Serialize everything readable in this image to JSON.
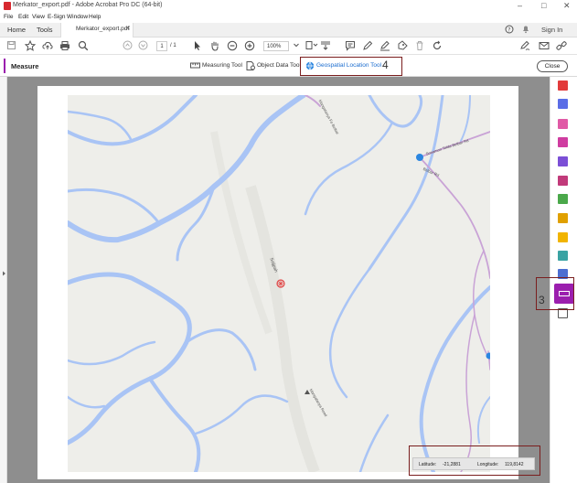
{
  "window": {
    "title": "Merkator_export.pdf - Adobe Acrobat Pro DC (64-bit)",
    "controls": [
      "–",
      "□",
      "✕"
    ]
  },
  "menu": [
    "File",
    "Edit",
    "View",
    "E-Sign",
    "Window",
    "Help"
  ],
  "tabs": {
    "home": "Home",
    "tools": "Tools",
    "document": "Merkator_export.pdf",
    "document_close": "✕",
    "sign_in": "Sign In"
  },
  "toolbar": {
    "page_current": "1",
    "page_total": "/ 1",
    "zoom": "100%"
  },
  "measure": {
    "title": "Measure",
    "tools": [
      "Measuring Tool",
      "Object Data Tool",
      "Geospatial Location Tool"
    ],
    "close": "Close",
    "callout_number": "4"
  },
  "sidebar": {
    "callout_number": "3"
  },
  "map_labels": {
    "village": "Saijpah",
    "road_1": "Sonamon Tolda Belbar Rd",
    "road_2": "Belbar Rd",
    "road_3": "Mangatanya Road",
    "road_4": "Mangatanya Fo Belbar"
  },
  "coordinates": {
    "latitude_label": "Latitude:",
    "latitude_value": "-21,2881",
    "longitude_label": "Longitude:",
    "longitude_value": "119,8142"
  },
  "colors": {
    "accent": "#9b1fae",
    "callout_border": "#7a1e1e",
    "river": "#a9c4f5",
    "road": "#c9a3d6",
    "map_bg": "#eeeeea"
  }
}
